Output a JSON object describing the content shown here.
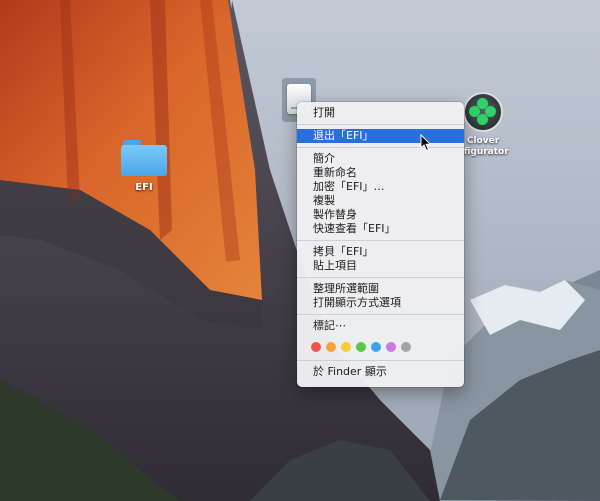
{
  "desktop": {
    "efi_folder": {
      "label": "EFI"
    },
    "clover": {
      "label_line1": "Clover",
      "label_line2": "nfigurator"
    }
  },
  "context_menu": {
    "open": "打開",
    "eject": "退出「EFI」",
    "get_info": "簡介",
    "rename": "重新命名",
    "encrypt": "加密「EFI」…",
    "duplicate": "複製",
    "make_alias": "製作替身",
    "quick_look": "快速查看「EFI」",
    "copy": "拷貝「EFI」",
    "paste": "貼上項目",
    "clean_up": "整理所選範圍",
    "show_view_options": "打開顯示方式選項",
    "tags": "標記⋯",
    "show_in_finder": "於 Finder 顯示",
    "tag_colors": {
      "red": "#f0524d",
      "orange": "#f7a237",
      "yellow": "#f6cd32",
      "green": "#5cc84a",
      "blue": "#3aa2f3",
      "purple": "#c97ae3",
      "gray": "#a4a4a8"
    }
  }
}
